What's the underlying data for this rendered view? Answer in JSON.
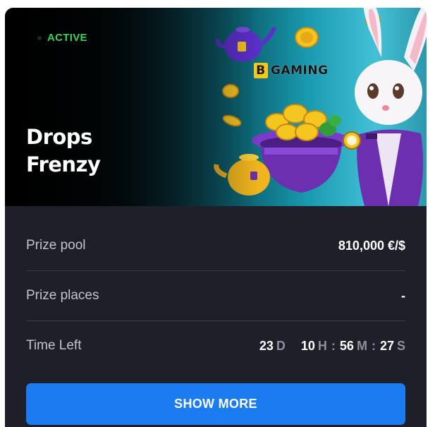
{
  "status_badge": "ACTIVE",
  "title_lines": [
    "Drops",
    "Frenzy"
  ],
  "provider": {
    "letter": "B",
    "rest": "GAMING"
  },
  "details": {
    "prize_pool": {
      "label": "Prize pool",
      "value": "810,000 €/$"
    },
    "prize_places": {
      "label": "Prize places",
      "value": "-"
    },
    "time_left": {
      "label": "Time Left",
      "days": "23",
      "days_unit": "D",
      "hours": "10",
      "hours_unit": "H",
      "minutes": "56",
      "minutes_unit": "M",
      "seconds": "27",
      "seconds_unit": "S",
      "separator": ":"
    }
  },
  "show_more_label": "SHOW MORE",
  "colors": {
    "card_bg": "#1f1f29",
    "active_green": "#3ed05c",
    "button_blue": "#1a7cf0",
    "gold": "#f3c81a",
    "purple": "#6b2fb0"
  }
}
